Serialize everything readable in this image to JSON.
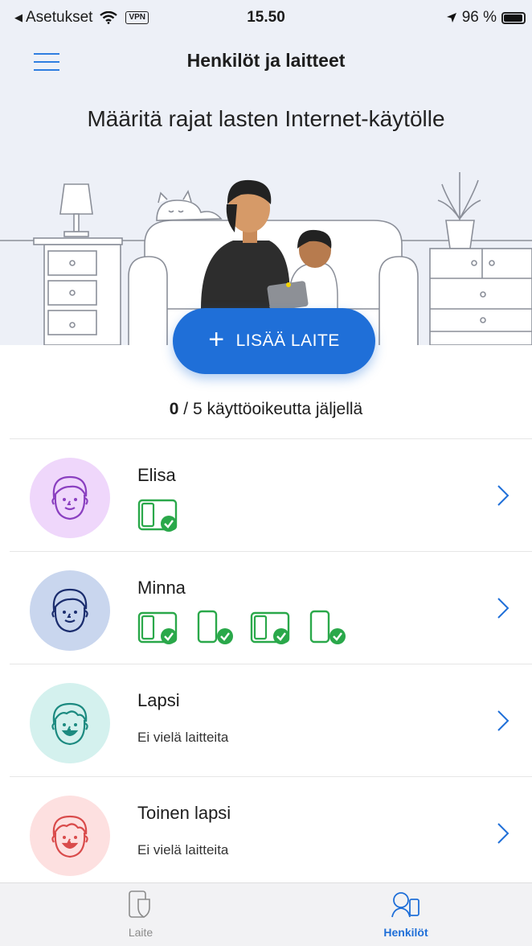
{
  "status_bar": {
    "back_app": "Asetukset",
    "vpn": "VPN",
    "time": "15.50",
    "battery": "96 %",
    "battery_level": 0.96
  },
  "header": {
    "title": "Henkilöt ja laitteet",
    "headline": "Määritä rajat lasten Internet-käytölle",
    "add_device_label": "LISÄÄ LAITE"
  },
  "license": {
    "used": "0",
    "rest": " / 5 käyttöoikeutta jäljellä"
  },
  "people": [
    {
      "name": "Elisa",
      "avatar_color": "#efd7fb",
      "avatar_stroke": "#8a3fc0",
      "devices": [
        "tablet"
      ],
      "status": ""
    },
    {
      "name": "Minna",
      "avatar_color": "#c9d6ee",
      "avatar_stroke": "#1b2d6e",
      "devices": [
        "tablet",
        "phone",
        "tablet",
        "phone"
      ],
      "status": ""
    },
    {
      "name": "Lapsi",
      "avatar_color": "#d4f1ee",
      "avatar_stroke": "#1c8a80",
      "devices": [],
      "status": "Ei vielä laitteita"
    },
    {
      "name": "Toinen lapsi",
      "avatar_color": "#fde0e0",
      "avatar_stroke": "#d94b4b",
      "devices": [],
      "status": "Ei vielä laitteita"
    }
  ],
  "tabs": {
    "laite": "Laite",
    "henkilot": "Henkilöt",
    "active": "henkilot"
  },
  "colors": {
    "accent": "#1f6fd8",
    "device_green": "#2aa84a",
    "header_bg": "#edf0f7"
  }
}
